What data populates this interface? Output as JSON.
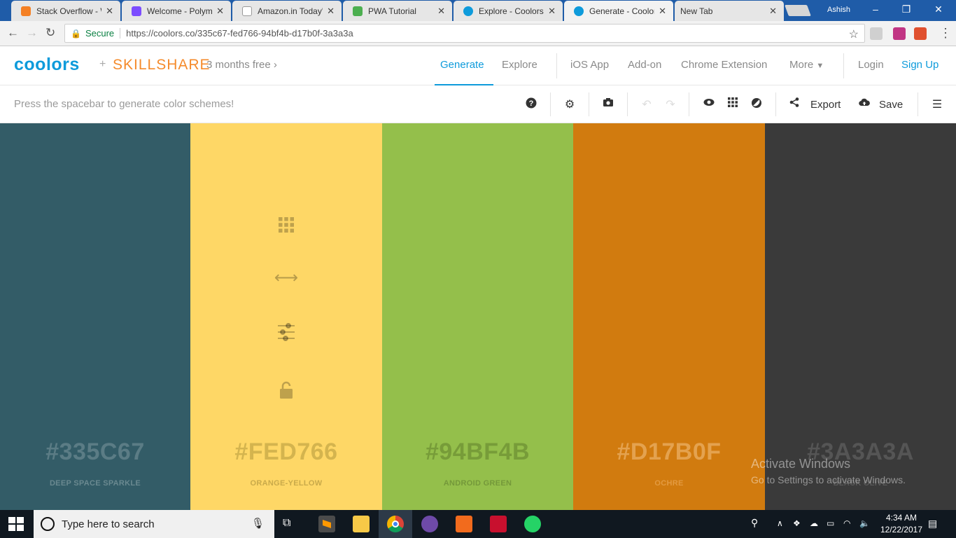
{
  "browser": {
    "tabs": [
      {
        "label": "Stack Overflow - W",
        "favicon_color": "#f48024"
      },
      {
        "label": "Welcome - Polyme",
        "favicon_color": "#7c4dff"
      },
      {
        "label": "Amazon.in Today's",
        "favicon_color": "#111111"
      },
      {
        "label": "PWA Tutorial",
        "favicon_color": "#4caf50"
      },
      {
        "label": "Explore - Coolors.c",
        "favicon_color": "#0e9bdb"
      },
      {
        "label": "Generate - Coolor",
        "favicon_color": "#0e9bdb",
        "active": true
      },
      {
        "label": "New Tab",
        "favicon_color": ""
      }
    ],
    "profile": "Ashish",
    "secure_label": "Secure",
    "url": "https://coolors.co/335c67-fed766-94bf4b-d17b0f-3a3a3a"
  },
  "site": {
    "logo": "coolors",
    "plus": "+",
    "partner": "SKILLSHARE",
    "promo": "3 months free",
    "nav": [
      "Generate",
      "Explore",
      "iOS App",
      "Add-on",
      "Chrome Extension",
      "More",
      "Login",
      "Sign Up"
    ],
    "hint": "Press the spacebar to generate color schemes!",
    "export_label": "Export",
    "save_label": "Save",
    "accent": "#0e9bdb"
  },
  "palette": [
    {
      "hex": "#335C67",
      "name": "DEEP SPACE SPARKLE",
      "color": "#335c67",
      "text_color": "#5b7c85",
      "name_color": "#6a8990"
    },
    {
      "hex": "#FED766",
      "name": "ORANGE-YELLOW",
      "color": "#fed766",
      "text_color": "#d4b44e",
      "name_color": "#c9aa4a"
    },
    {
      "hex": "#94BF4B",
      "name": "ANDROID GREEN",
      "color": "#94bf4b",
      "text_color": "#779c39",
      "name_color": "#74983a"
    },
    {
      "hex": "#D17B0F",
      "name": "OCHRE",
      "color": "#d17b0f",
      "text_color": "#e4a24f",
      "name_color": "#e39a40"
    },
    {
      "hex": "#3A3A3A",
      "name": "BLACK OLIVE",
      "color": "#3a3a3a",
      "text_color": "#555555",
      "name_color": "#5a5a5a"
    }
  ],
  "watermark": {
    "line1": "Activate Windows",
    "line2": "Go to Settings to activate Windows."
  },
  "taskbar": {
    "search_placeholder": "Type here to search",
    "time": "4:34 AM",
    "date": "12/22/2017"
  }
}
